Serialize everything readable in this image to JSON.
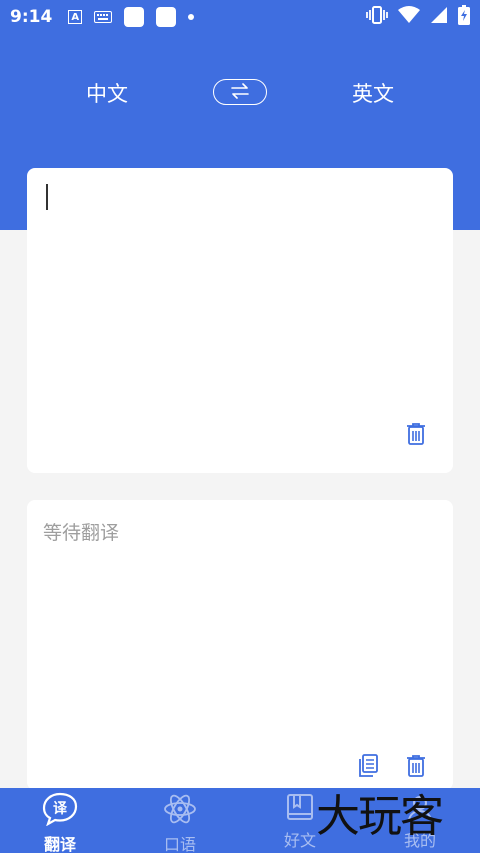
{
  "status_bar": {
    "time": "9:14",
    "notif_a": "A"
  },
  "lang_bar": {
    "source": "中文",
    "target": "英文",
    "swap_icon": "swap-arrows-icon"
  },
  "input_card": {
    "value": "",
    "delete_icon": "trash-icon"
  },
  "output_card": {
    "placeholder": "等待翻译",
    "copy_icon": "copy-icon",
    "delete_icon": "trash-icon"
  },
  "tabs": [
    {
      "label": "翻译",
      "icon": "translate-bubble-icon",
      "active": true
    },
    {
      "label": "口语",
      "icon": "atom-icon",
      "active": false
    },
    {
      "label": "好文",
      "icon": "book-icon",
      "active": false
    },
    {
      "label": "我的",
      "icon": "profile-icon",
      "active": false
    }
  ],
  "watermark": "大玩客",
  "colors": {
    "primary": "#3f6ee0",
    "background": "#f4f4f4",
    "placeholder": "#9e9e9e"
  }
}
